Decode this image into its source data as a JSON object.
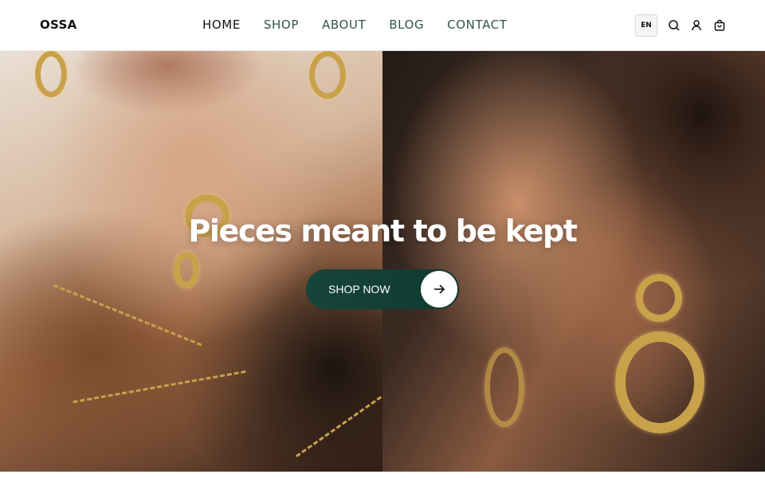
{
  "header": {
    "logo": "OSSA",
    "nav": [
      {
        "label": "HOME",
        "active": true
      },
      {
        "label": "SHOP",
        "active": false
      },
      {
        "label": "ABOUT",
        "active": false
      },
      {
        "label": "BLOG",
        "active": false
      },
      {
        "label": "CONTACT",
        "active": false
      }
    ],
    "language": "EN",
    "icons": [
      "search-icon",
      "user-icon",
      "cart-icon"
    ]
  },
  "hero": {
    "title": "Pieces meant to be kept",
    "cta_label": "SHOP NOW",
    "cta_icon": "arrow-right-icon",
    "images": [
      "hands-with-gold-rings-and-chains-photo",
      "profile-with-gold-earring-photo"
    ]
  },
  "colors": {
    "nav_text": "#2f5646",
    "cta_background": "#17453a",
    "jewelry_gold": "#c9a14a"
  }
}
